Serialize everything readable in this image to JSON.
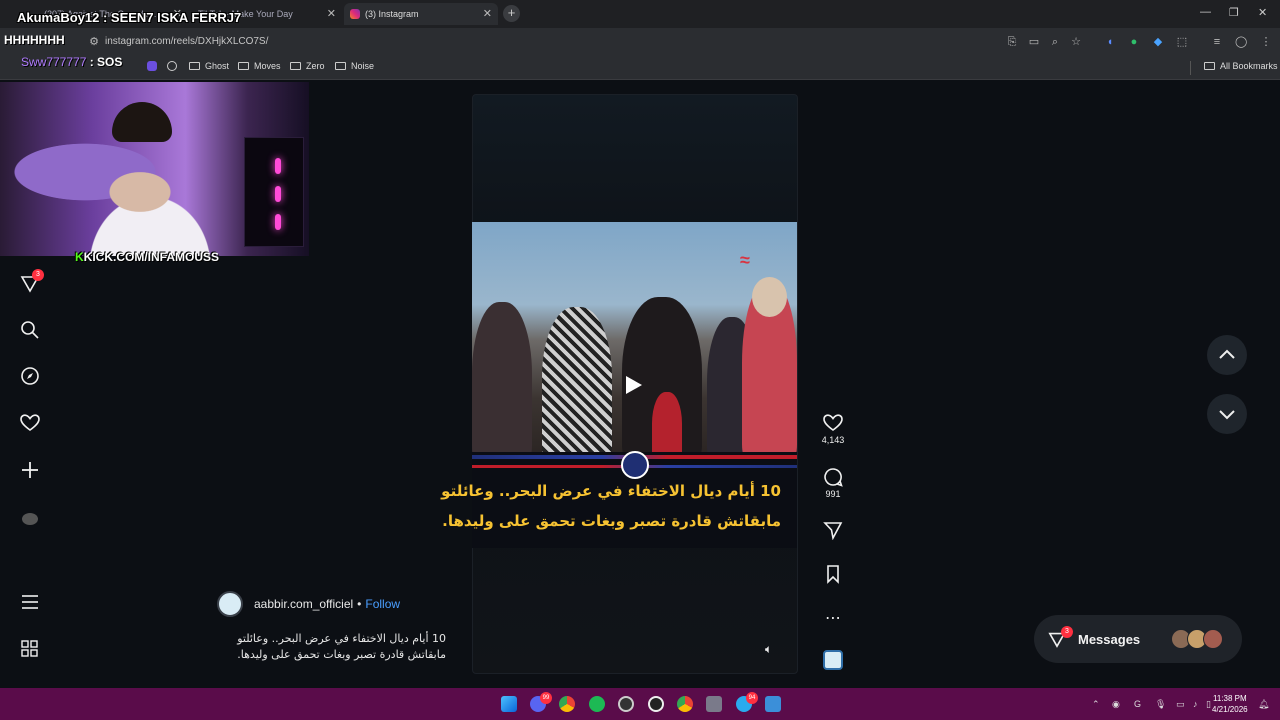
{
  "browser": {
    "tabs": [
      {
        "label": "(207) Against The Crowd ro..."
      },
      {
        "label": "TikTok - Make Your Day"
      },
      {
        "label": "(3) Instagram",
        "active": true
      }
    ],
    "url": "instagram.com/reels/DXHjkXLCO7S/",
    "bookmarks": [
      "Ghost",
      "Moves",
      "Zero",
      "Noise"
    ],
    "all_bookmarks": "All Bookmarks"
  },
  "stream_overlay": {
    "alert_name": "AkumaBoy12 : SEEN7 ISKA FERRJ7",
    "alert_line2": "HHHHHHH",
    "alert_line3_user": "Sww777777",
    "alert_line3_msg": " : SOS",
    "kick_prefix": "K",
    "kick_url": "KICK.COM/INFAMOUSS"
  },
  "instagram": {
    "notifications_badge": "3",
    "reel": {
      "headline_line1": "10 أيام ديال الاختفاء في عرض البحر.. وعائلتو",
      "headline_line2": "مابقاتش قادرة تصبر وبغات تحمق على وليدها.",
      "likes": "4,143",
      "comments": "991",
      "author": "aabbir.com_officiel",
      "follow_sep": "•",
      "follow": "Follow",
      "description_line1": "10 أيام ديال الاختفاء في عرض البحر.. وعائلتو",
      "description_line2": "مابقاتش قادرة تصبر وبغات تحمق على وليدها."
    },
    "messages": {
      "label": "Messages",
      "badge": "3"
    }
  },
  "taskbar": {
    "time": "11:38 PM",
    "date": "4/21/2026",
    "badges": {
      "discord": "99",
      "telegram": "94"
    }
  },
  "colors": {
    "accent": "#4a9eff",
    "badge": "#ff3040",
    "taskbar": "#5a0c4a",
    "headline": "#f6c232"
  }
}
